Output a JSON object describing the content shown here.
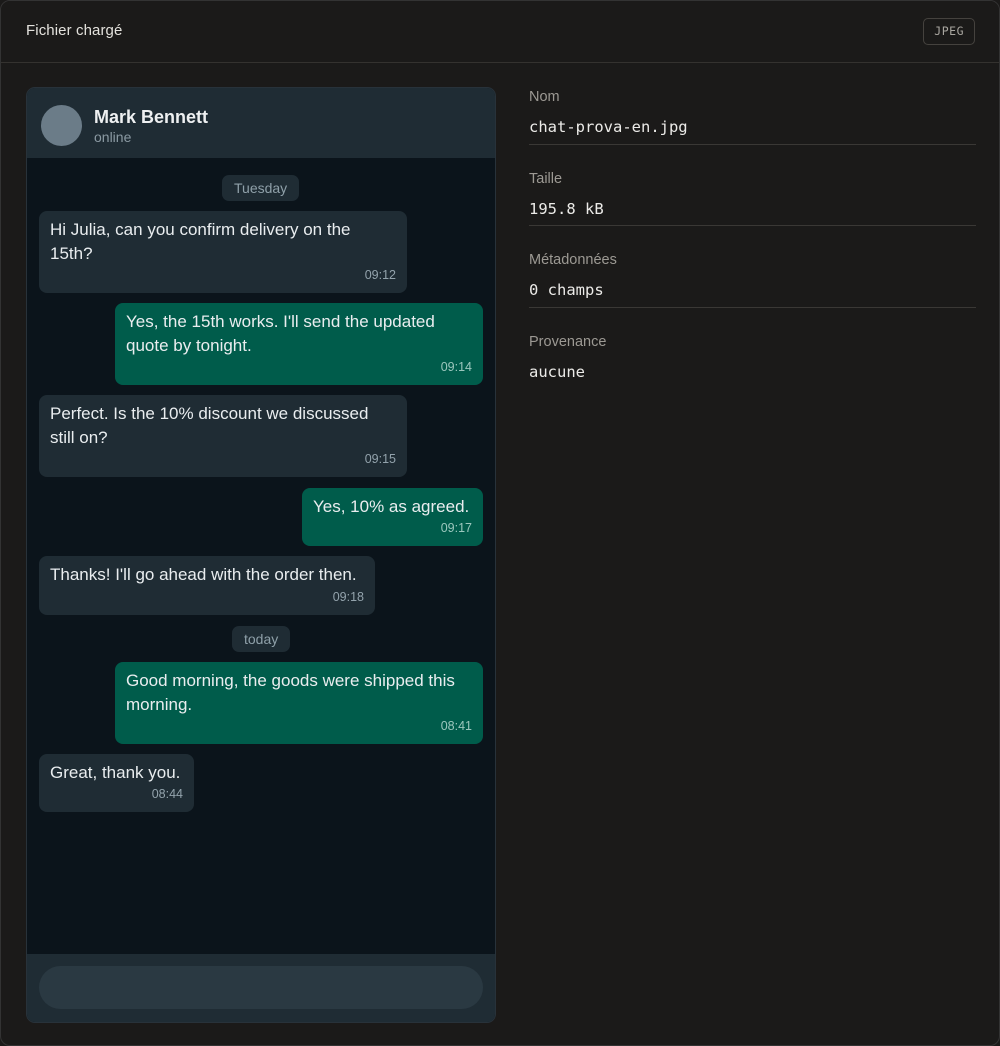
{
  "window": {
    "title": "Fichier chargé",
    "format_badge": "JPEG"
  },
  "chat": {
    "contact_name": "Mark Bennett",
    "contact_status": "online",
    "day_separators": [
      "Tuesday",
      "today"
    ],
    "messages": [
      {
        "direction": "in",
        "text": "Hi Julia, can you confirm delivery on the 15th?",
        "time": "09:12"
      },
      {
        "direction": "out",
        "text": "Yes, the 15th works. I'll send the updated quote by tonight.",
        "time": "09:14"
      },
      {
        "direction": "in",
        "text": "Perfect. Is the 10% discount we discussed still on?",
        "time": "09:15"
      },
      {
        "direction": "out",
        "text": "Yes, 10% as agreed.",
        "time": "09:17"
      },
      {
        "direction": "in",
        "text": "Thanks! I'll go ahead with the order then.",
        "time": "09:18"
      },
      {
        "direction": "out",
        "text": "Good morning, the goods were shipped this morning.",
        "time": "08:41"
      },
      {
        "direction": "in",
        "text": "Great, thank you.",
        "time": "08:44"
      }
    ]
  },
  "metadata": {
    "name_label": "Nom",
    "name_value": "chat-prova-en.jpg",
    "size_label": "Taille",
    "size_value": "195.8 kB",
    "fields_label": "Métadonnées",
    "fields_value": "0 champs",
    "provenance_label": "Provenance",
    "provenance_value": "aucune"
  },
  "colors": {
    "incoming_bubble": "#1f2c34",
    "outgoing_bubble": "#005c4b",
    "chat_background": "#0b141b",
    "panel_background": "#1b1a19"
  }
}
